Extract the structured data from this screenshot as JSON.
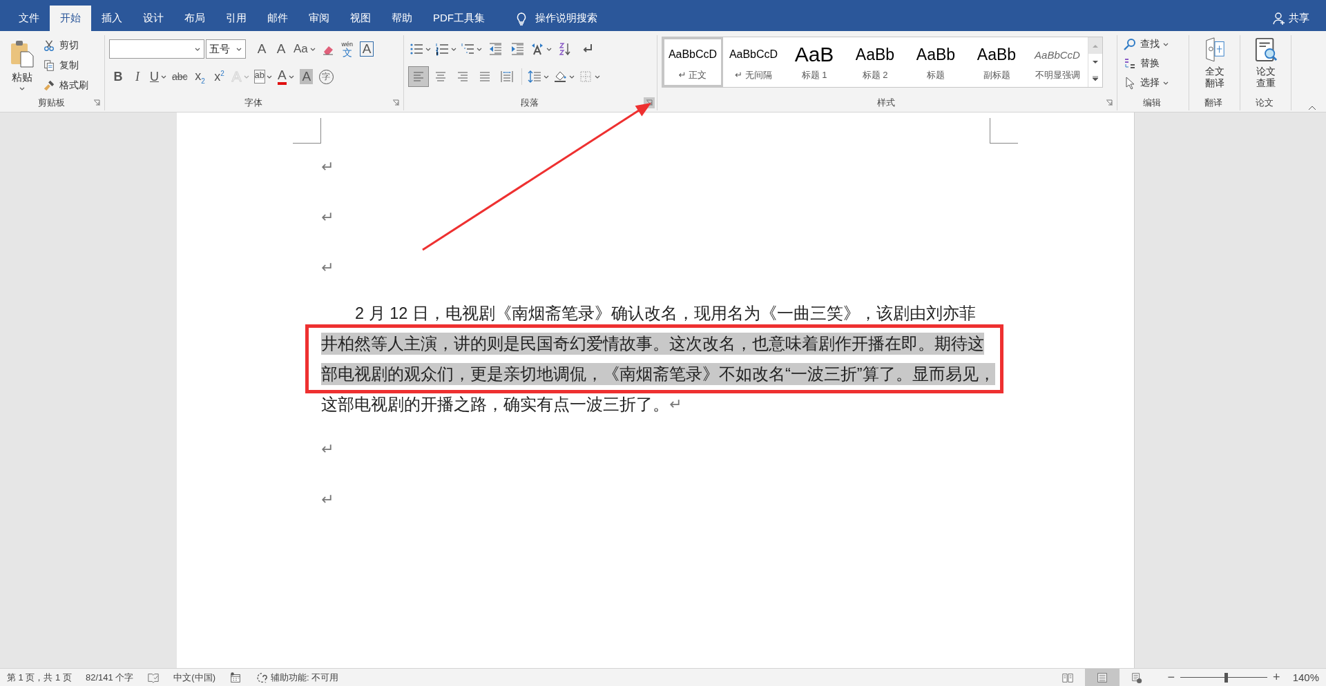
{
  "tabs": [
    {
      "label": "文件",
      "selected": false
    },
    {
      "label": "开始",
      "selected": true
    },
    {
      "label": "插入",
      "selected": false
    },
    {
      "label": "设计",
      "selected": false
    },
    {
      "label": "布局",
      "selected": false
    },
    {
      "label": "引用",
      "selected": false
    },
    {
      "label": "邮件",
      "selected": false
    },
    {
      "label": "审阅",
      "selected": false
    },
    {
      "label": "视图",
      "selected": false
    },
    {
      "label": "帮助",
      "selected": false
    },
    {
      "label": "PDF工具集",
      "selected": false
    }
  ],
  "tell_me": "操作说明搜索",
  "share": "共享",
  "ribbon": {
    "clipboard": {
      "label": "剪贴板",
      "launcher_active": false,
      "paste": "粘贴",
      "commands": [
        {
          "kind": "cut",
          "label": "剪切"
        },
        {
          "kind": "copy",
          "label": "复制"
        },
        {
          "kind": "format-painter",
          "label": "格式刷"
        }
      ]
    },
    "font": {
      "label": "字体",
      "launcher_active": false,
      "font_size": "五号",
      "row1": [
        {
          "kind": "grow",
          "label": "A",
          "dropdown": false,
          "disabled": false
        },
        {
          "kind": "shrink",
          "label": "A",
          "dropdown": false,
          "disabled": false
        },
        {
          "kind": "case",
          "label": "Aa",
          "dropdown": true,
          "disabled": false
        },
        {
          "kind": "clear",
          "dropdown": false,
          "disabled": false
        },
        {
          "kind": "phonetic",
          "label": "文",
          "ruby": "wén",
          "dropdown": false,
          "disabled": false
        },
        {
          "kind": "border",
          "label": "A",
          "dropdown": false,
          "disabled": false
        }
      ],
      "row2": [
        {
          "kind": "bold",
          "label": "B",
          "dropdown": false,
          "disabled": false
        },
        {
          "kind": "italic",
          "label": "I",
          "dropdown": false,
          "disabled": false
        },
        {
          "kind": "underline",
          "label": "U",
          "dropdown": true,
          "disabled": false
        },
        {
          "kind": "strike",
          "label": "abc",
          "dropdown": false,
          "disabled": false
        },
        {
          "kind": "sub",
          "label": "x",
          "script": "2",
          "dropdown": false,
          "disabled": false
        },
        {
          "kind": "sup",
          "label": "x",
          "script": "2",
          "dropdown": false,
          "disabled": false
        },
        {
          "kind": "effects",
          "label": "A",
          "dropdown": true,
          "disabled": true
        },
        {
          "kind": "highlight",
          "label": "ab",
          "dropdown": true,
          "disabled": false
        },
        {
          "kind": "color",
          "label": "A",
          "dropdown": true,
          "disabled": false
        },
        {
          "kind": "shading",
          "label": "A",
          "dropdown": false,
          "disabled": false
        },
        {
          "kind": "enclose",
          "label": "字",
          "dropdown": false,
          "disabled": false
        }
      ]
    },
    "paragraph": {
      "label": "段落",
      "launcher_active": true,
      "row1": [
        {
          "kind": "bullets",
          "dropdown": true
        },
        {
          "kind": "numbering",
          "dropdown": true
        },
        {
          "kind": "multilevel",
          "dropdown": true
        },
        {
          "kind": "outdent",
          "dropdown": false
        },
        {
          "kind": "indent",
          "dropdown": false
        },
        {
          "kind": "asian-layout",
          "dropdown": true
        },
        {
          "kind": "sort",
          "dropdown": false
        },
        {
          "kind": "show-marks",
          "dropdown": false
        }
      ],
      "alignment": [
        {
          "kind": "align-left",
          "selected": true
        },
        {
          "kind": "align-center",
          "selected": false
        },
        {
          "kind": "align-right",
          "selected": false
        },
        {
          "kind": "justify",
          "selected": false
        },
        {
          "kind": "distribute",
          "selected": false
        }
      ],
      "row2": [
        {
          "kind": "line-spacing",
          "dropdown": true
        },
        {
          "kind": "paint-bucket",
          "dropdown": true
        },
        {
          "kind": "borders",
          "dropdown": true
        }
      ]
    },
    "styles": {
      "label": "样式",
      "launcher_active": false,
      "items": [
        {
          "kind": "normal",
          "preview": "AaBbCcD",
          "name": "正文",
          "para_mark": "↵",
          "selected": true
        },
        {
          "kind": "normal",
          "preview": "AaBbCcD",
          "name": "无间隔",
          "para_mark": "↵",
          "selected": false
        },
        {
          "kind": "heading1",
          "preview": "AaB",
          "name": "标题 1",
          "selected": false
        },
        {
          "kind": "heading2",
          "preview": "AaBb",
          "name": "标题 2",
          "selected": false
        },
        {
          "kind": "title",
          "preview": "AaBb",
          "name": "标题",
          "selected": false
        },
        {
          "kind": "title",
          "preview": "AaBb",
          "name": "副标题",
          "selected": false
        },
        {
          "kind": "subtle",
          "preview": "AaBbCcD",
          "name": "不明显强调",
          "selected": false
        }
      ]
    },
    "editing": {
      "label": "编辑",
      "commands": [
        {
          "kind": "find",
          "label": "查找",
          "dropdown": true
        },
        {
          "kind": "replace",
          "label": "替换",
          "dropdown": false
        },
        {
          "kind": "select",
          "label": "选择",
          "dropdown": true
        }
      ]
    },
    "translate": {
      "label": "翻译",
      "button": [
        "全文",
        "翻译"
      ]
    },
    "thesis": {
      "label": "论文",
      "button": [
        "论文",
        "查重"
      ]
    }
  },
  "document": {
    "paragraphs": [
      {
        "kind": "empty",
        "mark": "↵"
      },
      {
        "kind": "empty",
        "mark": "↵"
      },
      {
        "kind": "empty",
        "mark": "↵"
      },
      {
        "kind": "text",
        "mark": "↵",
        "lines": [
          {
            "text": "2 月 12 日，电视剧《南烟斋笔录》确认改名，现用名为《一曲三笑》，该剧由刘亦菲",
            "selected": false
          },
          {
            "text": "井柏然等人主演，讲的则是民国奇幻爱情故事。这次改名，也意味着剧作开播在即。期待这",
            "selected": true
          },
          {
            "text": "部电视剧的观众们，更是亲切地调侃，《南烟斋笔录》不如改名“一波三折”算了。显而易见，",
            "selected": true
          },
          {
            "text": "这部电视剧的开播之路，确实有点一波三折了。",
            "selected": false
          }
        ]
      },
      {
        "kind": "empty",
        "mark": "↵"
      },
      {
        "kind": "empty",
        "mark": "↵"
      }
    ]
  },
  "status_bar": {
    "page": "第 1 页，共 1 页",
    "words": "82/141 个字",
    "language": "中文(中国)",
    "accessibility": "辅助功能: 不可用",
    "views": [
      {
        "kind": "read",
        "selected": false
      },
      {
        "kind": "print",
        "selected": true
      },
      {
        "kind": "web",
        "selected": false
      }
    ],
    "zoom": {
      "minus": "−",
      "plus": "+",
      "level": 0.52,
      "reading": "140%"
    }
  }
}
